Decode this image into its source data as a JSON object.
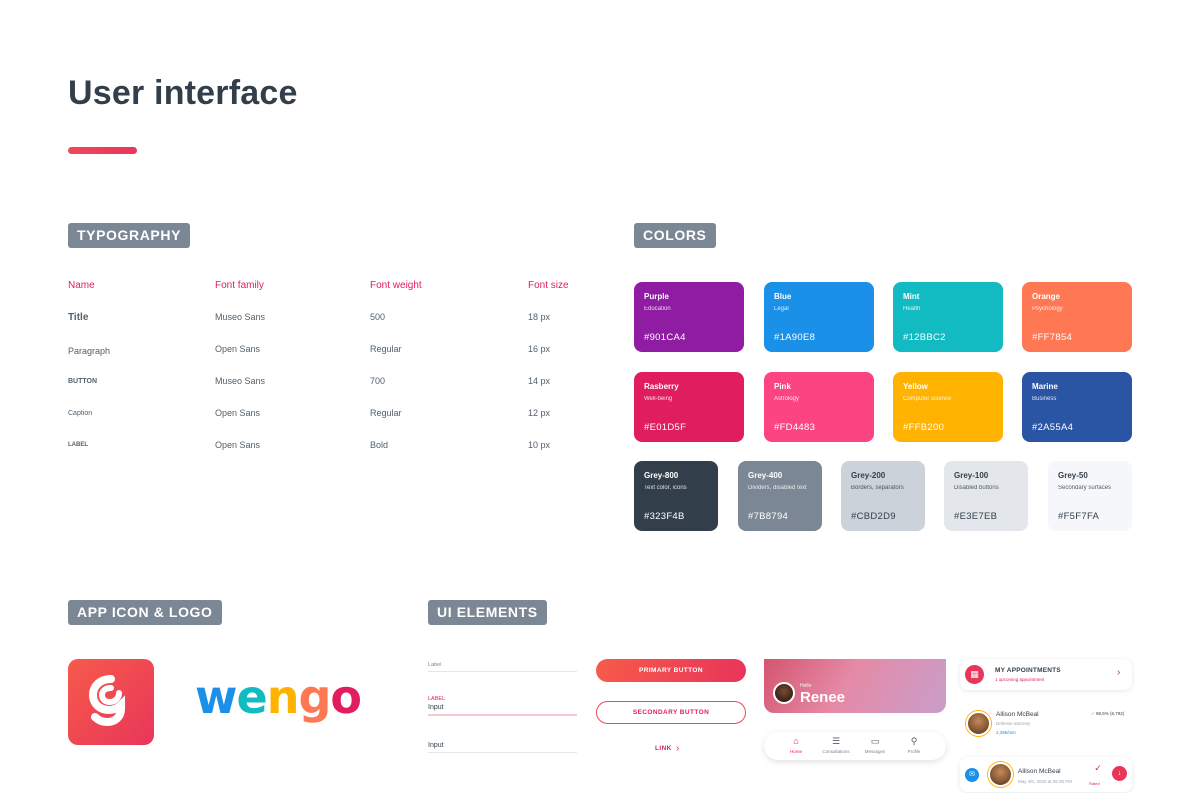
{
  "page": {
    "title": "User interface"
  },
  "sections": {
    "typography": "TYPOGRAPHY",
    "colors": "COLORS",
    "app_icon_logo": "APP ICON & LOGO",
    "ui_elements": "UI ELEMENTS"
  },
  "typography": {
    "headers": [
      "Name",
      "Font family",
      "Font weight",
      "Font size"
    ],
    "rows": [
      [
        "Title",
        "Museo Sans",
        "500",
        "18 px"
      ],
      [
        "Paragraph",
        "Open Sans",
        "Regular",
        "16 px"
      ],
      [
        "BUTTON",
        "Museo Sans",
        "700",
        "14 px"
      ],
      [
        "Caption",
        "Open Sans",
        "Regular",
        "12 px"
      ],
      [
        "LABEL",
        "Open Sans",
        "Bold",
        "10 px"
      ]
    ]
  },
  "colors": [
    {
      "name": "Purple",
      "sub": "Education",
      "hex": "#901CA4",
      "color": "#901CA4"
    },
    {
      "name": "Blue",
      "sub": "Legal",
      "hex": "#1A90E8",
      "color": "#1A90E8"
    },
    {
      "name": "Mint",
      "sub": "Health",
      "hex": "#12BBC2",
      "color": "#12BBC2"
    },
    {
      "name": "Orange",
      "sub": "Psychology",
      "hex": "#FF7854",
      "color": "#FF7854"
    },
    {
      "name": "Rasberry",
      "sub": "Well-being",
      "hex": "#E01D5F",
      "color": "#E01D5F"
    },
    {
      "name": "Pink",
      "sub": "Astrology",
      "hex": "#FD4483",
      "color": "#FD4483"
    },
    {
      "name": "Yellow",
      "sub": "Computer science",
      "hex": "#FFB200",
      "color": "#FFB200"
    },
    {
      "name": "Marine",
      "sub": "Business",
      "hex": "#2A55A4",
      "color": "#2A55A4"
    },
    {
      "name": "Grey-800",
      "sub": "Text color, icons",
      "hex": "#323F4B",
      "color": "#323F4B"
    },
    {
      "name": "Grey-400",
      "sub": "Dividers, disabled text",
      "hex": "#7B8794",
      "color": "#7B8794"
    },
    {
      "name": "Grey-200",
      "sub": "Borders, separators",
      "hex": "#CBD2D9",
      "color": "#CBD2D9"
    },
    {
      "name": "Grey-100",
      "sub": "Disabled buttons",
      "hex": "#E3E7EB",
      "color": "#E3E7EB"
    },
    {
      "name": "Grey-50",
      "sub": "Secondary surfaces",
      "hex": "#F5F7FA",
      "color": "#F5F7FA"
    }
  ],
  "logo": {
    "letters": [
      "w",
      "e",
      "n",
      "g",
      "o"
    ]
  },
  "ui": {
    "fields": [
      {
        "label": "Label",
        "value": ""
      },
      {
        "label": "LABEL",
        "value": "Input"
      },
      {
        "label": "",
        "value": "Input"
      }
    ],
    "primary_button": "PRIMARY BUTTON",
    "secondary_button": "SECONDARY BUTTON",
    "link": "LINK",
    "hello": {
      "greeting": "Hello",
      "name": "Renee"
    },
    "tabs": [
      "Home",
      "Consultations",
      "Messages",
      "Profile"
    ],
    "appointments": {
      "title": "MY APPOINTMENTS",
      "sub": "1 upcoming appointment"
    },
    "expert": {
      "name": "Allison McBeal",
      "role": "Defense attorney",
      "price": "2,39€/min",
      "stat": "98,5% (6,792)"
    },
    "message": {
      "name": "Allison McBeal",
      "date": "May 4th, 2020 at 06:35 PM",
      "rated": "Rated"
    }
  }
}
